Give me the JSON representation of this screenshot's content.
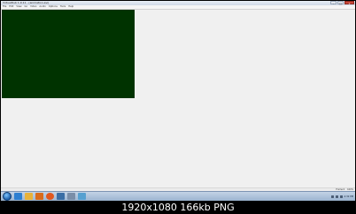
{
  "window": {
    "title": "VirtualDub 1.9.11 - (animation.avi)",
    "controls": {
      "minimize": "–",
      "maximize": "□",
      "close": "x"
    }
  },
  "menu": [
    "File",
    "Edit",
    "View",
    "Go",
    "Video",
    "Audio",
    "Options",
    "Tools",
    "Help"
  ],
  "viewport": {
    "background_color": "#003300"
  },
  "status": {
    "left": "",
    "frame": "Frame 0",
    "zoom": "100%"
  },
  "taskbar": {
    "icons": [
      "windows-start-icon",
      "ie-icon",
      "folder-icon",
      "media-player-icon",
      "firefox-icon",
      "app-icon",
      "virtualdub-icon",
      "app-icon-2"
    ],
    "clock": "4:32 PM"
  },
  "caption": "1920x1080 166kb PNG"
}
